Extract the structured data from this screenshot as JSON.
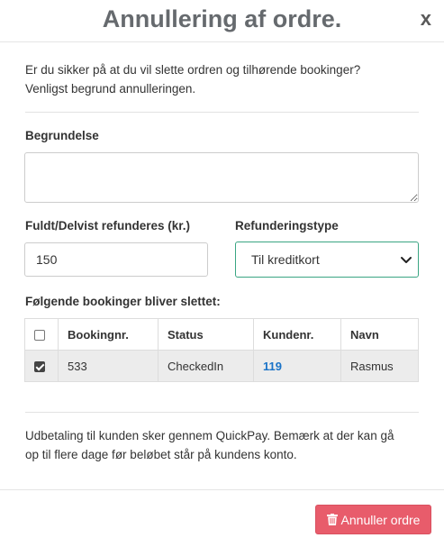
{
  "modal": {
    "title": "Annullering af ordre.",
    "close_label": "x"
  },
  "intro": {
    "line1": "Er du sikker på at du vil slette ordren og tilhørende bookinger?",
    "line2": "Venligst begrund annulleringen."
  },
  "form": {
    "reason_label": "Begrundelse",
    "reason_value": "",
    "amount_label": "Fuldt/Delvist refunderes (kr.)",
    "amount_value": "150",
    "refund_type_label": "Refunderingstype",
    "refund_type_value": "Til kreditkort",
    "bookings_heading": "Følgende bookinger bliver slettet:"
  },
  "table": {
    "columns": [
      "Bookingnr.",
      "Status",
      "Kundenr.",
      "Navn"
    ],
    "header_checked": false,
    "rows": [
      {
        "checked": true,
        "booking": "533",
        "status": "CheckedIn",
        "customer": "119",
        "name": "Rasmus"
      }
    ]
  },
  "notice": {
    "line1": "Udbetaling til kunden sker gennem QuickPay. Bemærk at der kan gå",
    "line2": "op til flere dage før beløbet står på kundens konto."
  },
  "footer": {
    "cancel_button": "Annuller ordre"
  },
  "colors": {
    "danger": "#e85c6b",
    "focus_border": "#3aa583",
    "link": "#1a73c8"
  },
  "icons": {
    "close": "close-icon",
    "chevron": "chevron-down-icon",
    "trash": "trash-icon"
  }
}
